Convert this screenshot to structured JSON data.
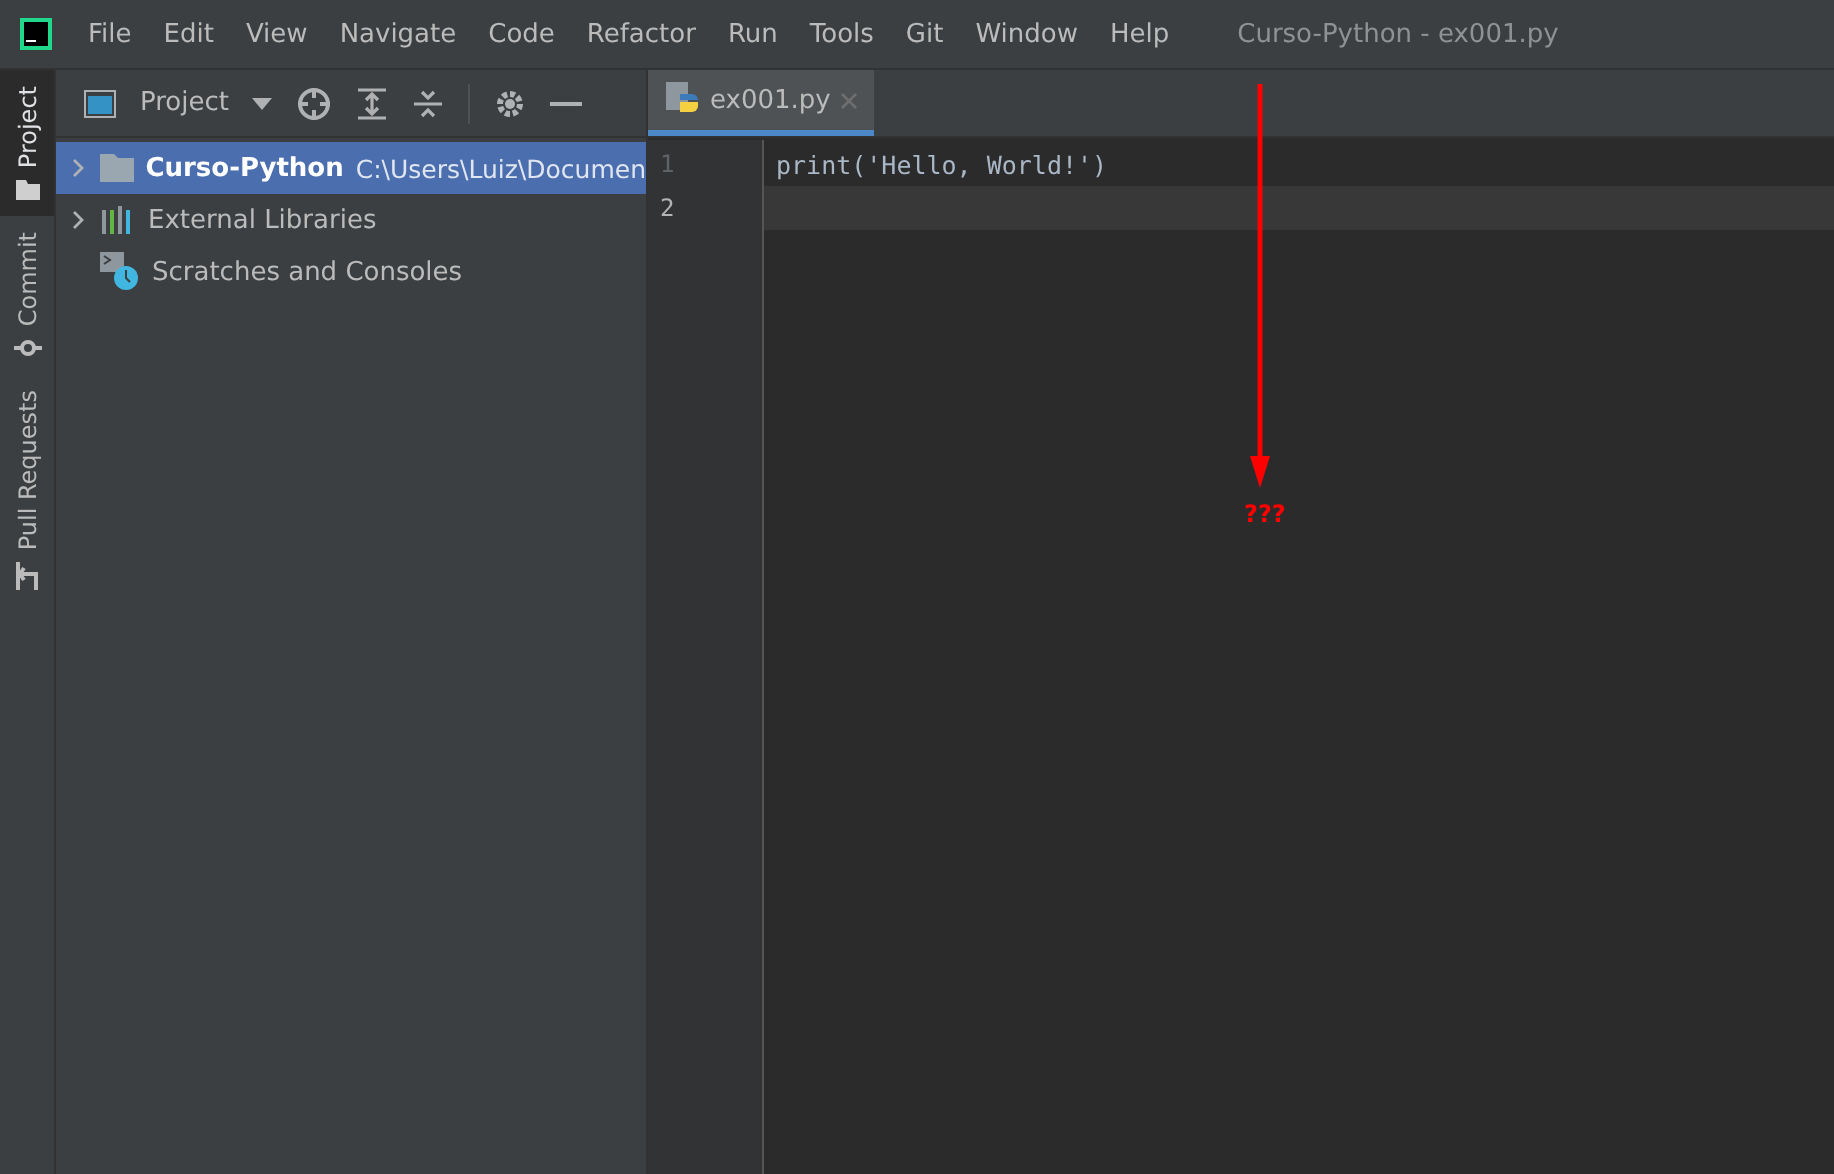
{
  "menu_bar": {
    "items": [
      "File",
      "Edit",
      "View",
      "Navigate",
      "Code",
      "Refactor",
      "Run",
      "Tools",
      "Git",
      "Window",
      "Help"
    ],
    "title": "Curso-Python - ex001.py"
  },
  "side_stripe": {
    "tabs": [
      {
        "label": "Project",
        "kind": "folder",
        "selected": true
      },
      {
        "label": "Commit",
        "kind": "commit",
        "selected": false
      },
      {
        "label": "Pull Requests",
        "kind": "pull",
        "selected": false
      }
    ]
  },
  "project_panel": {
    "title": "Project",
    "tree": [
      {
        "name": "Curso-Python",
        "path": "C:\\Users\\Luiz\\Documen",
        "kind": "folder",
        "expanded": false,
        "selected": true
      },
      {
        "name": "External Libraries",
        "kind": "libraries",
        "expanded": false,
        "selected": false
      },
      {
        "name": "Scratches and Consoles",
        "kind": "scratches",
        "selected": false
      }
    ]
  },
  "editor": {
    "tabs": [
      {
        "label": "ex001.py",
        "selected": true
      }
    ],
    "lines": [
      {
        "number": "1",
        "code": "print('Hello, World!')",
        "current": false
      },
      {
        "number": "2",
        "current": true
      }
    ]
  },
  "annotation": {
    "text": "???"
  }
}
